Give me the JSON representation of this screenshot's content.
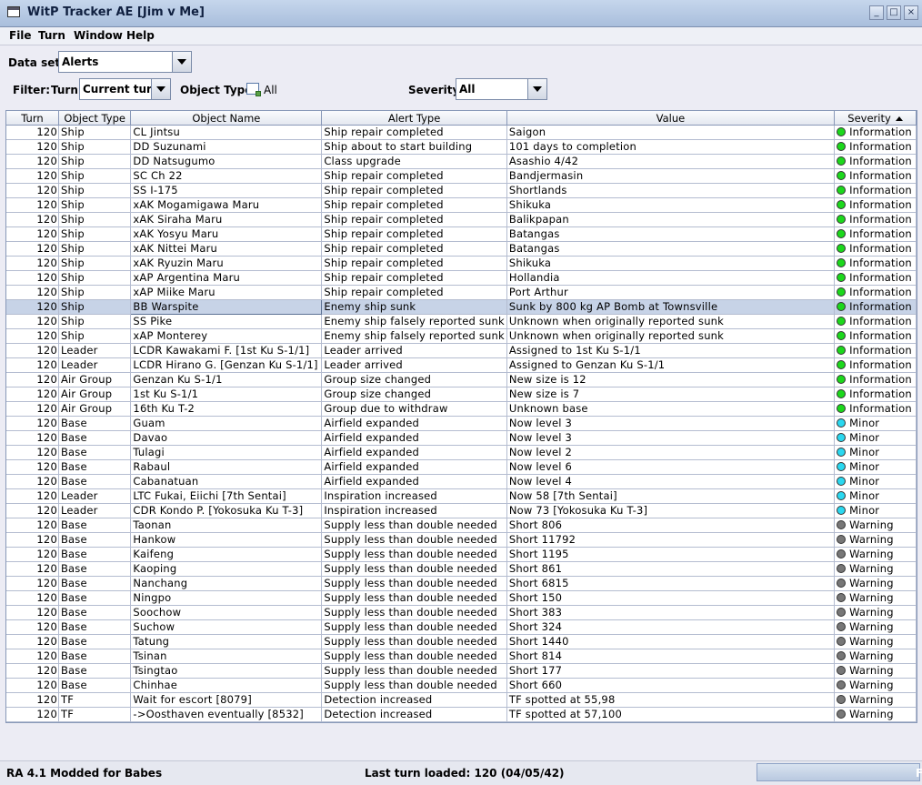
{
  "window": {
    "title": "WitP Tracker AE [Jim v Me]",
    "app_icon": "window-icon",
    "buttons": [
      "minimize",
      "maximize",
      "close"
    ]
  },
  "menu": [
    "File",
    "Turn",
    "Window",
    "Help"
  ],
  "dataset": {
    "label": "Data set:",
    "value": "Alerts"
  },
  "filter": {
    "label": "Filter:",
    "turn_label": "Turn:",
    "turn_value": "Current turn",
    "object_type_label": "Object Type:",
    "object_type_value": "All",
    "severity_label": "Severity:",
    "severity_value": "All"
  },
  "table": {
    "columns": [
      "Turn",
      "Object Type",
      "Object Name",
      "Alert Type",
      "Value",
      "Severity"
    ],
    "sort_column": "Severity",
    "selected_row": 12,
    "severity_colors": {
      "Information": "#1cd81c",
      "Minor": "#2ad8f0",
      "Warning": "#777777"
    },
    "rows": [
      [
        "120",
        "Ship",
        "CL Jintsu",
        "Ship repair completed",
        "Saigon",
        "Information"
      ],
      [
        "120",
        "Ship",
        "DD Suzunami",
        "Ship about to start building",
        "101 days to completion",
        "Information"
      ],
      [
        "120",
        "Ship",
        "DD Natsugumo",
        "Class upgrade",
        "Asashio 4/42",
        "Information"
      ],
      [
        "120",
        "Ship",
        "SC Ch 22",
        "Ship repair completed",
        "Bandjermasin",
        "Information"
      ],
      [
        "120",
        "Ship",
        "SS I-175",
        "Ship repair completed",
        "Shortlands",
        "Information"
      ],
      [
        "120",
        "Ship",
        "xAK Mogamigawa Maru",
        "Ship repair completed",
        "Shikuka",
        "Information"
      ],
      [
        "120",
        "Ship",
        "xAK Siraha Maru",
        "Ship repair completed",
        "Balikpapan",
        "Information"
      ],
      [
        "120",
        "Ship",
        "xAK Yosyu Maru",
        "Ship repair completed",
        "Batangas",
        "Information"
      ],
      [
        "120",
        "Ship",
        "xAK Nittei Maru",
        "Ship repair completed",
        "Batangas",
        "Information"
      ],
      [
        "120",
        "Ship",
        "xAK Ryuzin Maru",
        "Ship repair completed",
        "Shikuka",
        "Information"
      ],
      [
        "120",
        "Ship",
        "xAP Argentina Maru",
        "Ship repair completed",
        "Hollandia",
        "Information"
      ],
      [
        "120",
        "Ship",
        "xAP Miike Maru",
        "Ship repair completed",
        "Port Arthur",
        "Information"
      ],
      [
        "120",
        "Ship",
        "BB Warspite",
        "Enemy ship sunk",
        "Sunk by 800 kg AP Bomb at Townsville",
        "Information"
      ],
      [
        "120",
        "Ship",
        "SS Pike",
        "Enemy ship falsely reported sunk",
        "Unknown when originally reported sunk",
        "Information"
      ],
      [
        "120",
        "Ship",
        "xAP Monterey",
        "Enemy ship falsely reported sunk",
        "Unknown when originally reported sunk",
        "Information"
      ],
      [
        "120",
        "Leader",
        "LCDR Kawakami F. [1st Ku S-1/1]",
        "Leader arrived",
        "Assigned to 1st Ku S-1/1",
        "Information"
      ],
      [
        "120",
        "Leader",
        "LCDR Hirano G. [Genzan Ku S-1/1]",
        "Leader arrived",
        "Assigned to Genzan Ku S-1/1",
        "Information"
      ],
      [
        "120",
        "Air Group",
        "Genzan Ku S-1/1",
        "Group size changed",
        "New size is 12",
        "Information"
      ],
      [
        "120",
        "Air Group",
        "1st Ku S-1/1",
        "Group size changed",
        "New size is 7",
        "Information"
      ],
      [
        "120",
        "Air Group",
        "16th Ku T-2",
        "Group due to withdraw",
        "Unknown base",
        "Information"
      ],
      [
        "120",
        "Base",
        "Guam",
        "Airfield expanded",
        "Now level 3",
        "Minor"
      ],
      [
        "120",
        "Base",
        "Davao",
        "Airfield expanded",
        "Now level 3",
        "Minor"
      ],
      [
        "120",
        "Base",
        "Tulagi",
        "Airfield expanded",
        "Now level 2",
        "Minor"
      ],
      [
        "120",
        "Base",
        "Rabaul",
        "Airfield expanded",
        "Now level 6",
        "Minor"
      ],
      [
        "120",
        "Base",
        "Cabanatuan",
        "Airfield expanded",
        "Now level 4",
        "Minor"
      ],
      [
        "120",
        "Leader",
        "LTC Fukai, Eiichi [7th Sentai]",
        "Inspiration increased",
        "Now 58 [7th Sentai]",
        "Minor"
      ],
      [
        "120",
        "Leader",
        "CDR Kondo P. [Yokosuka Ku T-3]",
        "Inspiration increased",
        "Now 73 [Yokosuka Ku T-3]",
        "Minor"
      ],
      [
        "120",
        "Base",
        "Taonan",
        "Supply less than double needed",
        "Short 806",
        "Warning"
      ],
      [
        "120",
        "Base",
        "Hankow",
        "Supply less than double needed",
        "Short 11792",
        "Warning"
      ],
      [
        "120",
        "Base",
        "Kaifeng",
        "Supply less than double needed",
        "Short 1195",
        "Warning"
      ],
      [
        "120",
        "Base",
        "Kaoping",
        "Supply less than double needed",
        "Short 861",
        "Warning"
      ],
      [
        "120",
        "Base",
        "Nanchang",
        "Supply less than double needed",
        "Short 6815",
        "Warning"
      ],
      [
        "120",
        "Base",
        "Ningpo",
        "Supply less than double needed",
        "Short 150",
        "Warning"
      ],
      [
        "120",
        "Base",
        "Soochow",
        "Supply less than double needed",
        "Short 383",
        "Warning"
      ],
      [
        "120",
        "Base",
        "Suchow",
        "Supply less than double needed",
        "Short 324",
        "Warning"
      ],
      [
        "120",
        "Base",
        "Tatung",
        "Supply less than double needed",
        "Short 1440",
        "Warning"
      ],
      [
        "120",
        "Base",
        "Tsinan",
        "Supply less than double needed",
        "Short 814",
        "Warning"
      ],
      [
        "120",
        "Base",
        "Tsingtao",
        "Supply less than double needed",
        "Short 177",
        "Warning"
      ],
      [
        "120",
        "Base",
        "Chinhae",
        "Supply less than double needed",
        "Short 660",
        "Warning"
      ],
      [
        "120",
        "TF",
        "Wait for escort [8079]",
        "Detection increased",
        "TF spotted at 55,98",
        "Warning"
      ],
      [
        "120",
        "TF",
        "->Oosthaven eventually [8532]",
        "Detection increased",
        "TF spotted at 57,100",
        "Warning"
      ]
    ]
  },
  "status": {
    "left": "RA 4.1 Modded for Babes",
    "center": "Last turn loaded: 120 (04/05/42)",
    "progress_text": "F"
  }
}
